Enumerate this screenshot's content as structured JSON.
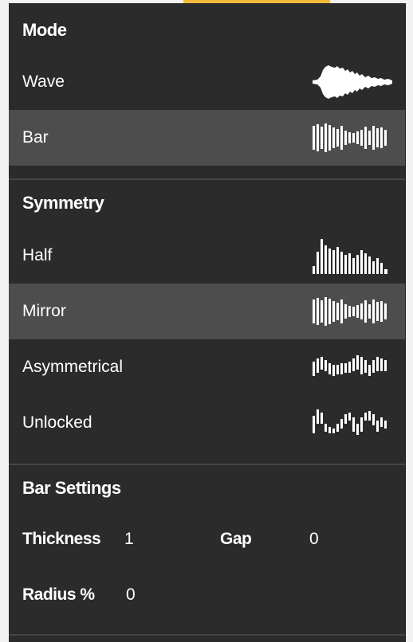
{
  "mode": {
    "title": "Mode",
    "items": [
      {
        "label": "Wave",
        "icon": "wave-waveform-icon",
        "selected": false
      },
      {
        "label": "Bar",
        "icon": "bar-waveform-icon",
        "selected": true
      }
    ]
  },
  "symmetry": {
    "title": "Symmetry",
    "items": [
      {
        "label": "Half",
        "icon": "half-bars-icon",
        "selected": false
      },
      {
        "label": "Mirror",
        "icon": "mirror-bars-icon",
        "selected": true
      },
      {
        "label": "Asymmetrical",
        "icon": "asymmetrical-bars-icon",
        "selected": false
      },
      {
        "label": "Unlocked",
        "icon": "unlocked-bars-icon",
        "selected": false
      }
    ]
  },
  "bar_settings": {
    "title": "Bar Settings",
    "thickness": {
      "label": "Thickness",
      "value": "1"
    },
    "gap": {
      "label": "Gap",
      "value": "0"
    },
    "radius": {
      "label": "Radius %",
      "value": "0"
    }
  },
  "colors": {
    "panel": "#2b2b2b",
    "selected_row": "#4d4d4d",
    "accent": "#f5b93a",
    "text": "#ffffff"
  }
}
